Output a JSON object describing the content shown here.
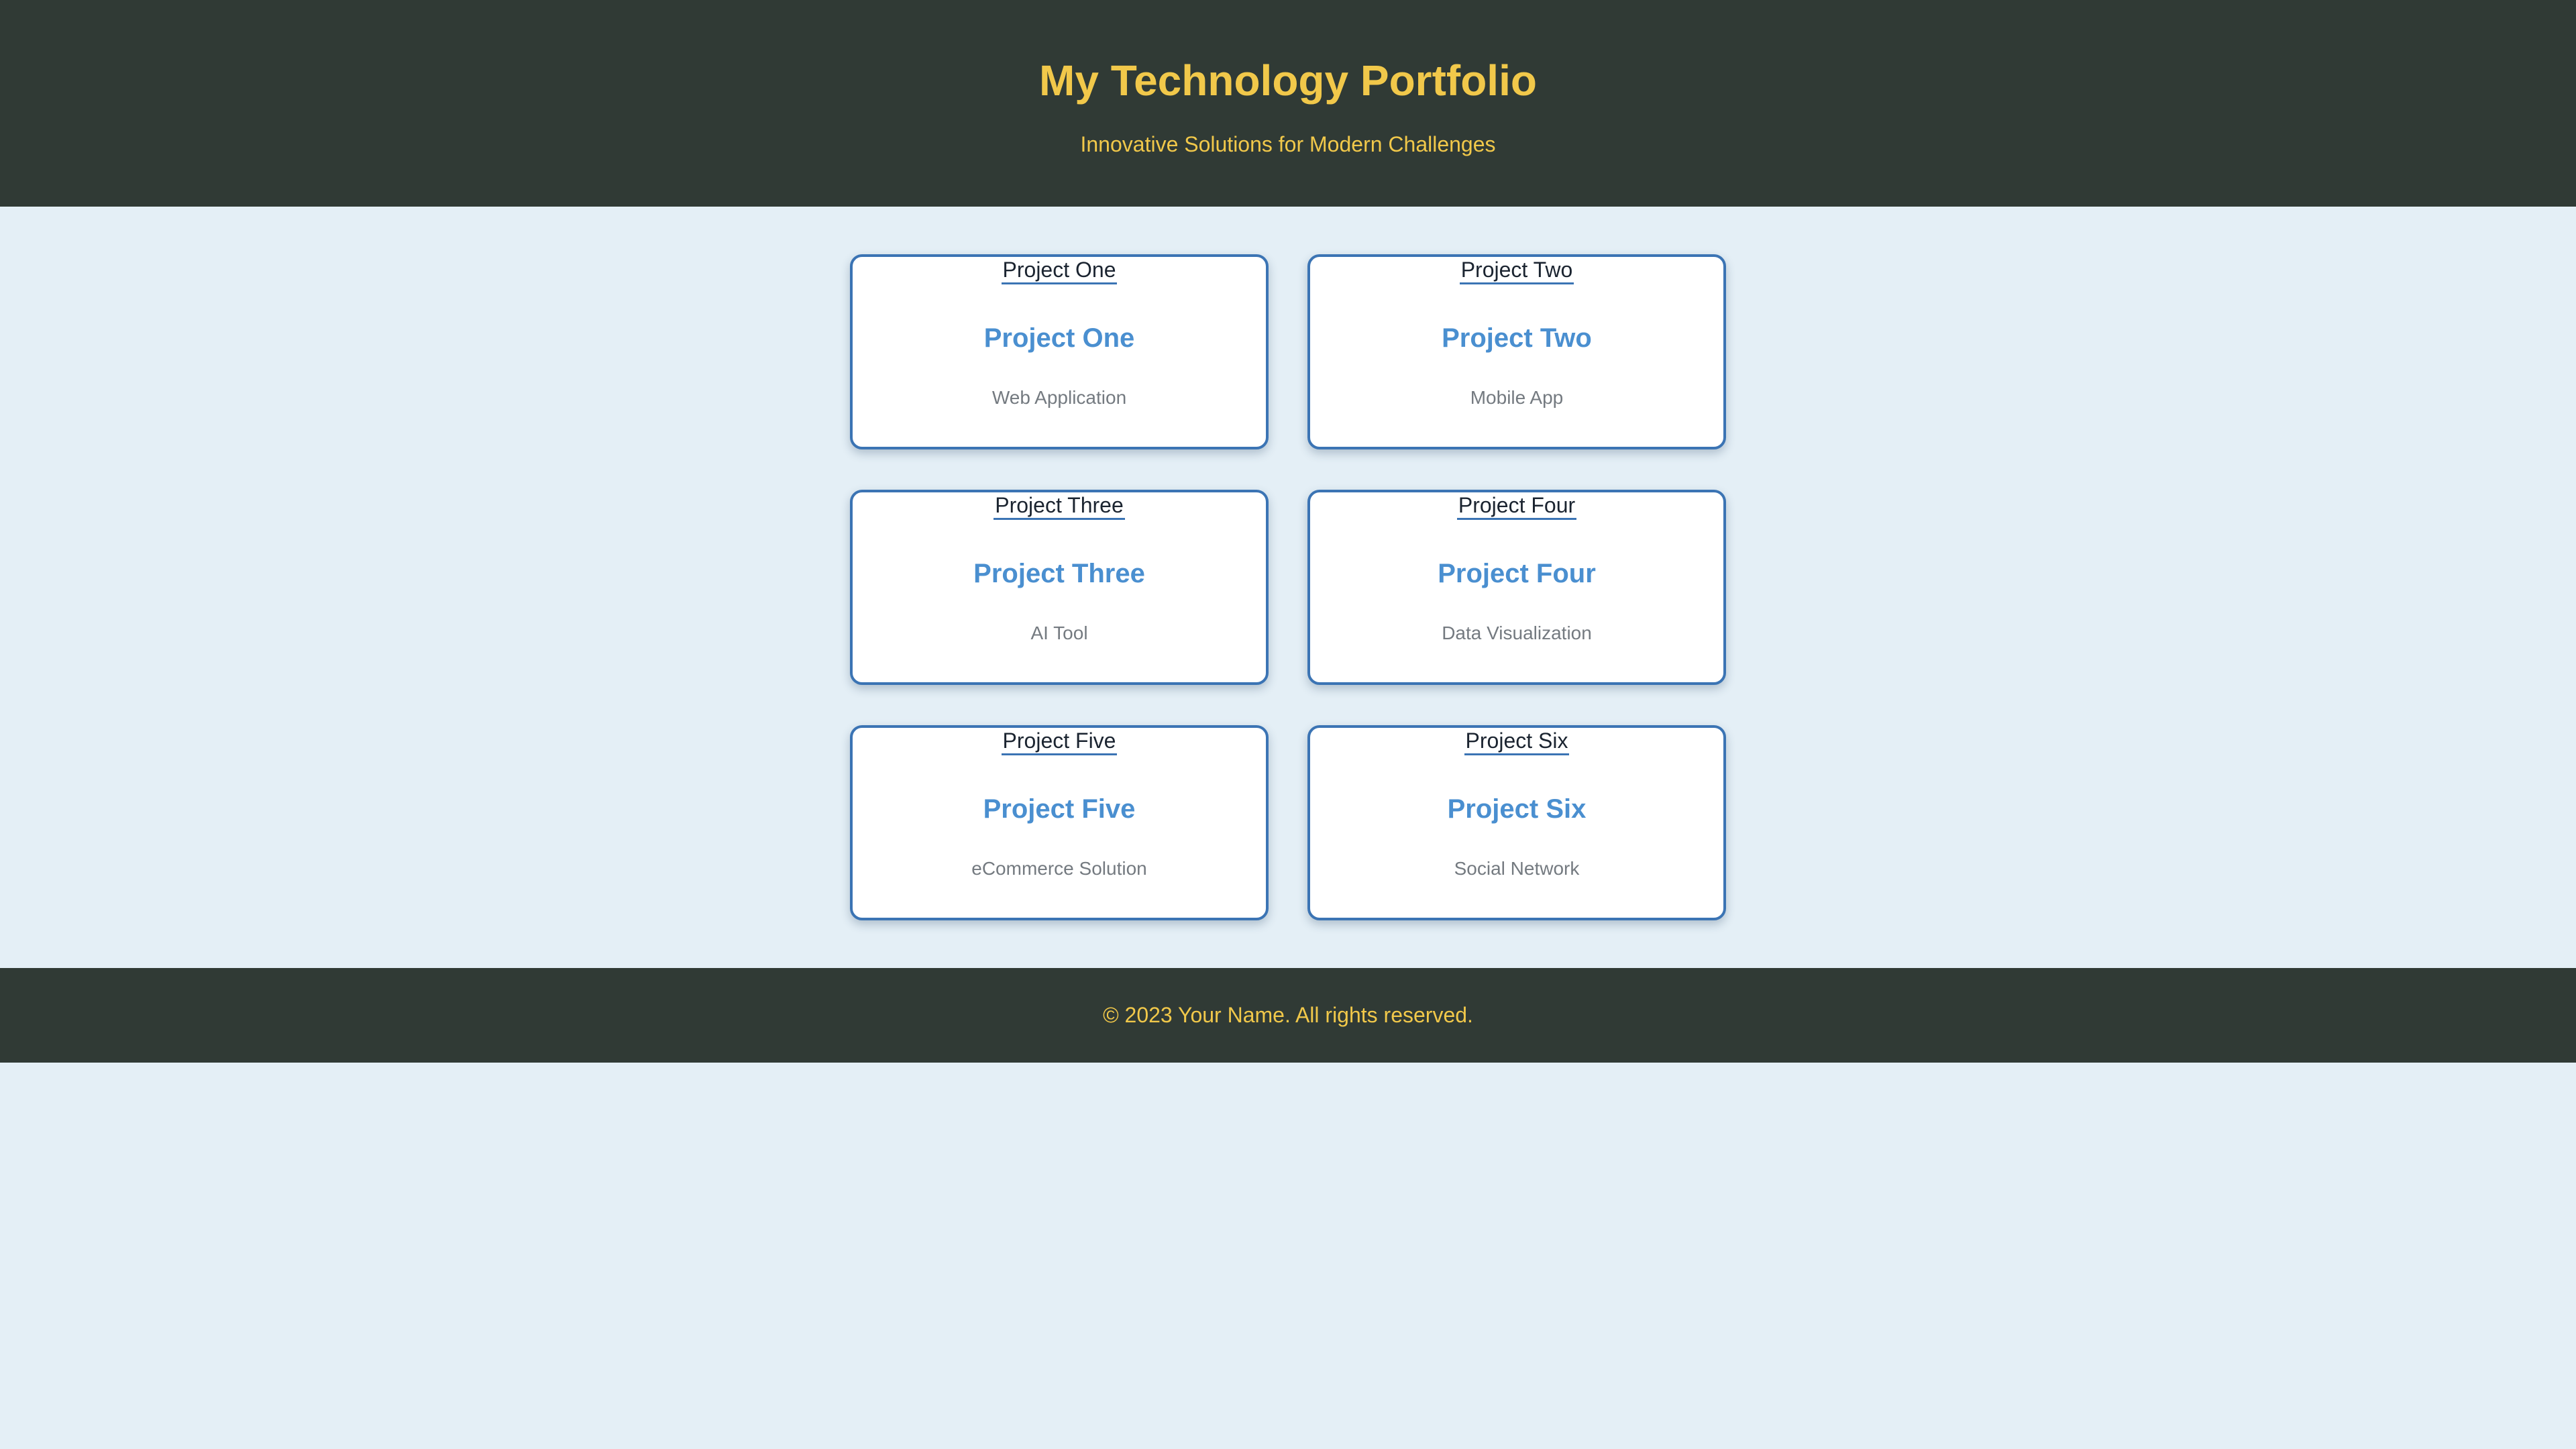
{
  "header": {
    "title": "My Technology Portfolio",
    "tagline": "Innovative Solutions for Modern Challenges"
  },
  "projects": [
    {
      "image_alt": "Project One",
      "title": "Project One",
      "type": "Web Application"
    },
    {
      "image_alt": "Project Two",
      "title": "Project Two",
      "type": "Mobile App"
    },
    {
      "image_alt": "Project Three",
      "title": "Project Three",
      "type": "AI Tool"
    },
    {
      "image_alt": "Project Four",
      "title": "Project Four",
      "type": "Data Visualization"
    },
    {
      "image_alt": "Project Five",
      "title": "Project Five",
      "type": "eCommerce Solution"
    },
    {
      "image_alt": "Project Six",
      "title": "Project Six",
      "type": "Social Network"
    }
  ],
  "footer": {
    "text": "© 2023 Your Name. All rights reserved."
  },
  "colors": {
    "header_bg": "#303a35",
    "accent_yellow": "#f1c84a",
    "page_bg": "#e4eff6",
    "card_border": "#3b74b4",
    "card_title": "#4a8fd0"
  }
}
